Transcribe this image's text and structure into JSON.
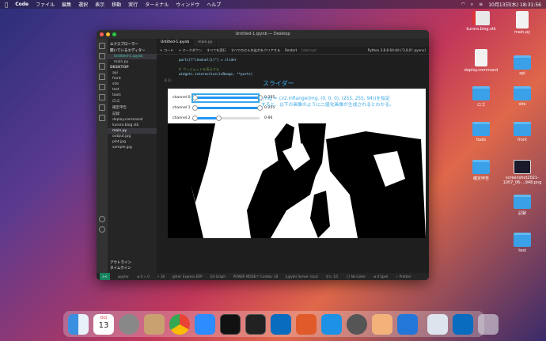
{
  "menubar": {
    "apple": "",
    "app": "Code",
    "items": [
      "ファイル",
      "編集",
      "選択",
      "表示",
      "移動",
      "実行",
      "ターミナル",
      "ウィンドウ",
      "ヘルプ"
    ],
    "clock": "10月13日(水) 18:31:56"
  },
  "window": {
    "title": "Untitled-1.ipynb — Desktop",
    "tabs": [
      "Untitled-1.ipynb",
      "main.py"
    ],
    "toolbar": [
      "+ コード",
      "+ マークダウン",
      "すべてを実行",
      "すべてのセルの出力をクリアする",
      "Restart",
      "Interrupt"
    ],
    "kernel": "Python 3.8.8 64-bit ('3.8.8': pyenv)"
  },
  "explorer": {
    "header": "エクスプローラー",
    "open_editors": "開いているエディター",
    "files_open": [
      "Untitled-1.ipynb",
      "main.py"
    ],
    "section": "DESKTOP",
    "items": [
      "api",
      "front",
      "site",
      "test",
      "tools",
      "ロゴ",
      "確定申告",
      "記録",
      "deploy.command",
      "kuroro.blog.stk",
      "main.py",
      "output.jpg",
      "plot.jpg",
      "sample.jpg"
    ],
    "outline": "アウトライン",
    "timeline": "タイムライン"
  },
  "code": {
    "line1": "parts[f\"channel{i}\"] = slider",
    "comment": "# ウィジェットを表示する",
    "line2": "widgets.interactive(inRange, **parts)",
    "exec_time": "8.2s"
  },
  "output": {
    "sliders": [
      {
        "label": "channel 0",
        "value": "0-255",
        "low": 0,
        "high": 1.0
      },
      {
        "label": "channel 1",
        "value": "0-255",
        "low": 0,
        "high": 1.0
      },
      {
        "label": "channel 2",
        "value": "0-94",
        "low": 0,
        "high": 0.369
      }
    ],
    "slider_title": "スライダー",
    "annotation": "_img = cv2.inRange(img, (0, 0, 0), (255, 255, 94))を指定すると、以下の画像のように二値化画像が生成されるとわかる。"
  },
  "statusbar": {
    "remote": "><",
    "items": [
      "jupyter",
      "⊗ 0 ⚠ 0",
      "⚡ 18",
      "gitrel: Express ERP",
      "Git Graph",
      "POWER MODE!!! Combo: 18",
      "Jupyter Server: local",
      "セル 1/1",
      "{} No Linter",
      "⊗ 0 Spell",
      "✓ Prettier"
    ]
  },
  "desktop_icons": [
    {
      "label": "kuroro.blog.stk",
      "kind": "stk"
    },
    {
      "label": "main.py",
      "kind": "doc"
    },
    {
      "label": "deploy.command",
      "kind": "doc"
    },
    {
      "label": "api",
      "kind": "folder"
    },
    {
      "label": "ロゴ",
      "kind": "folder"
    },
    {
      "label": "site",
      "kind": "folder"
    },
    {
      "label": "tools",
      "kind": "folder"
    },
    {
      "label": "front",
      "kind": "folder"
    },
    {
      "label": "確定申告",
      "kind": "folder"
    },
    {
      "label": "screenshot2021-1007_06-...948.png",
      "kind": "image"
    },
    {
      "label": "記録",
      "kind": "folder"
    },
    {
      "label": "test",
      "kind": "folder"
    }
  ],
  "dock": {
    "apps": [
      "finder",
      "calendar",
      "system-preferences",
      "contacts",
      "chrome",
      "zoom",
      "terminal",
      "terminal-2",
      "vscode",
      "git-app",
      "docker",
      "quicktime",
      "preview",
      "remote",
      "screenshot",
      "vscode-2",
      "trash"
    ],
    "calendar_month": "Oct",
    "calendar_day": "13"
  },
  "colors": {
    "accent": "#3aa8e8",
    "slider_fill": "#2196f3",
    "status_remote": "#16825d"
  }
}
